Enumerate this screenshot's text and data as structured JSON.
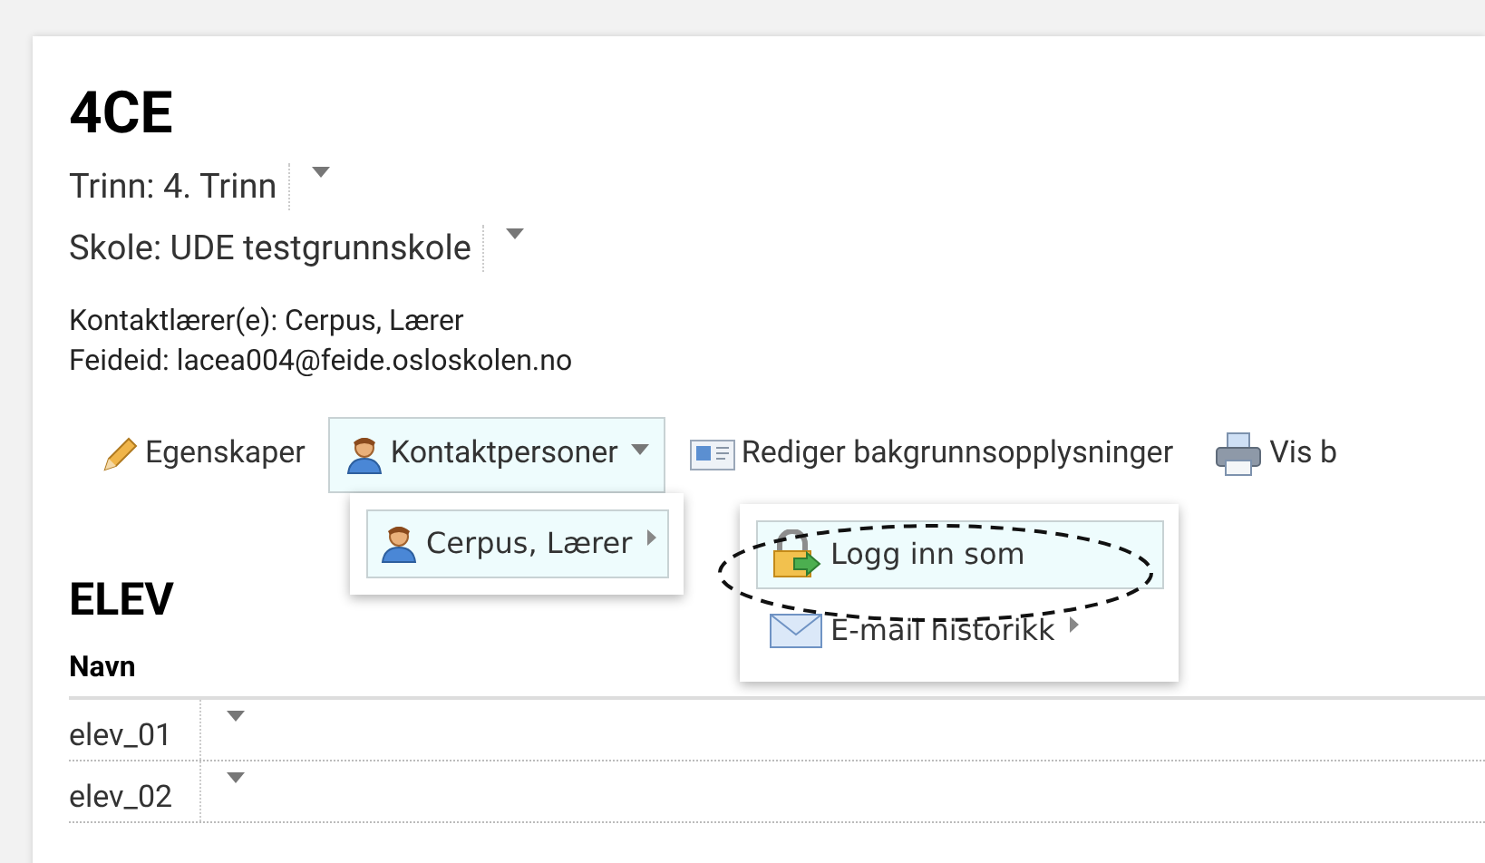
{
  "header": {
    "title": "4CE",
    "selectors": [
      {
        "label": "Trinn: 4. Trinn"
      },
      {
        "label": "Skole: UDE testgrunnskole"
      }
    ],
    "info": [
      "Kontaktlærer(e): Cerpus, Lærer",
      "Feideid: lacea004@feide.osloskolen.no"
    ]
  },
  "toolbar": [
    {
      "label": "Egenskaper",
      "kind": "pencil",
      "selected": false,
      "has_menu": false
    },
    {
      "label": "Kontaktpersoner",
      "kind": "person",
      "selected": true,
      "has_menu": true
    },
    {
      "label": "Rediger bakgrunnsopplysninger",
      "kind": "card",
      "selected": false,
      "has_menu": false
    },
    {
      "label": "Vis b",
      "kind": "printer",
      "selected": false,
      "has_menu": false
    }
  ],
  "contact_menu": [
    {
      "label": "Cerpus, Lærer",
      "kind": "person",
      "selected": true,
      "has_submenu": true
    }
  ],
  "submenu": [
    {
      "label": "Logg inn som",
      "kind": "lock",
      "selected": true,
      "has_submenu": false,
      "circled": true
    },
    {
      "label": "E-mail historikk",
      "kind": "mail",
      "selected": false,
      "has_submenu": true,
      "circled": false
    }
  ],
  "students": {
    "title": "ELEV",
    "columns": [
      "Navn"
    ],
    "rows": [
      {
        "name": "elev_01"
      },
      {
        "name": "elev_02"
      }
    ]
  }
}
